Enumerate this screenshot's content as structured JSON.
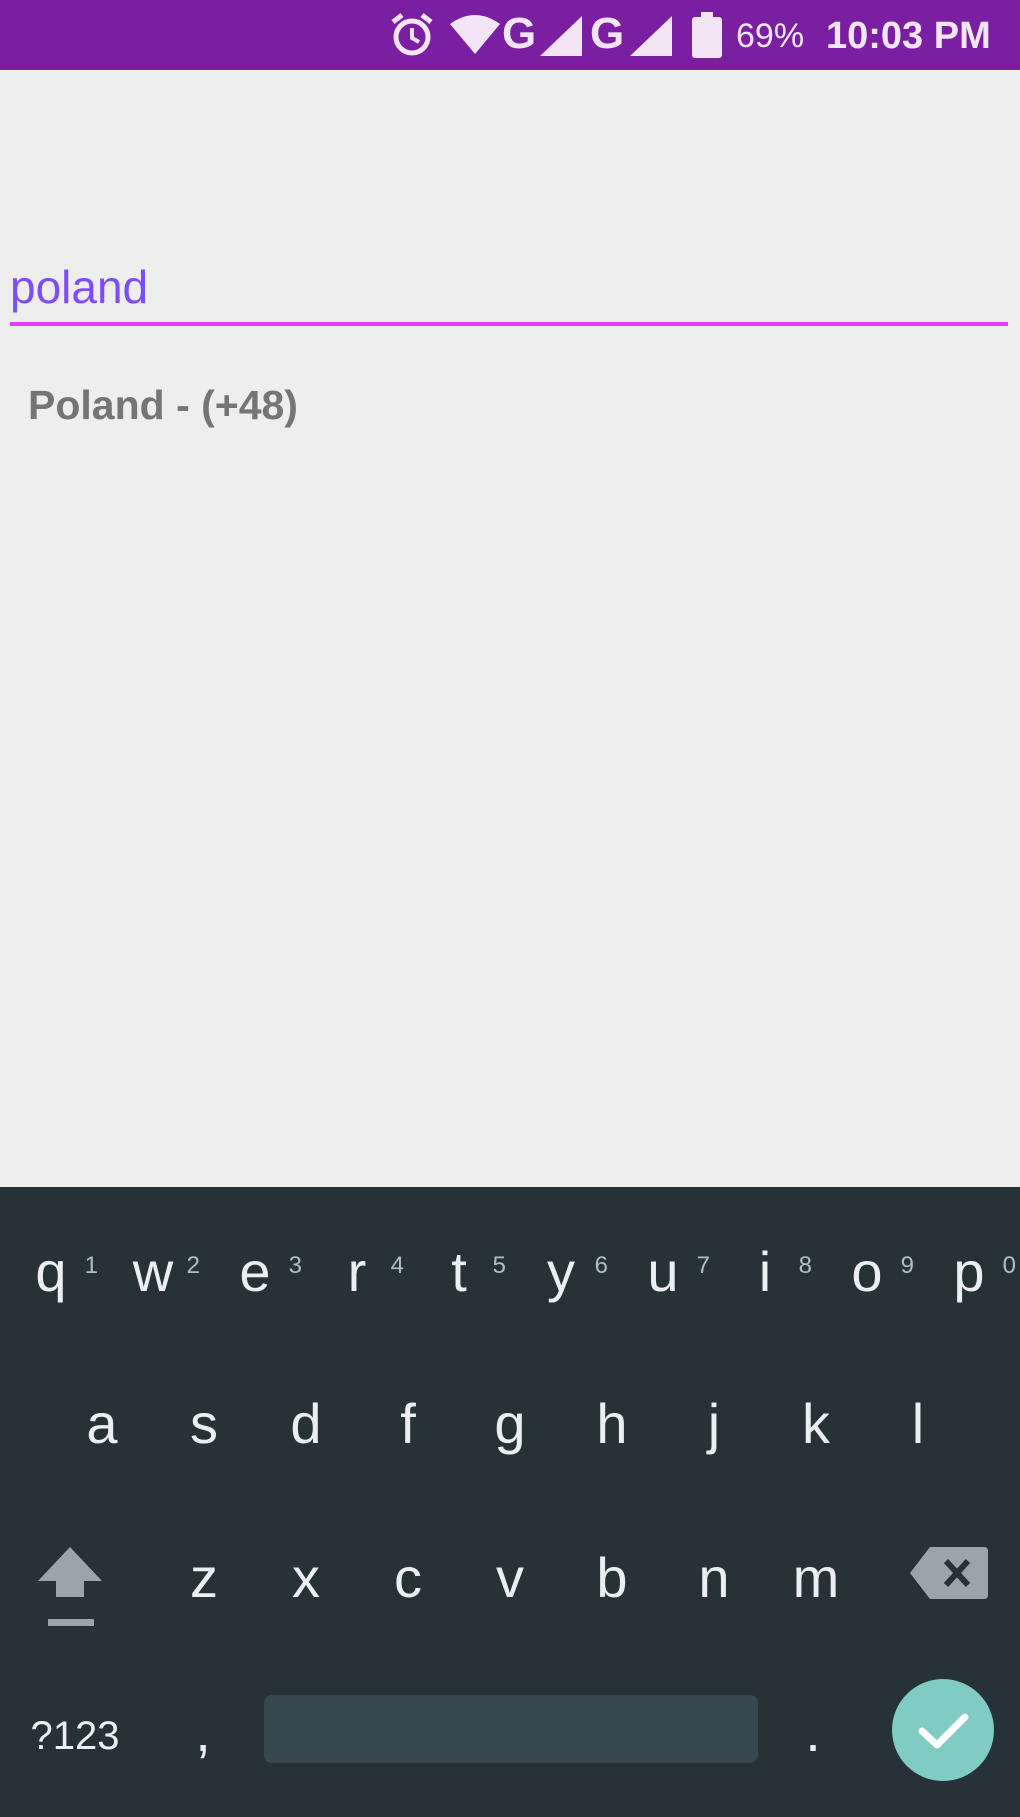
{
  "status_bar": {
    "network_g1": "G",
    "network_g2": "G",
    "battery": "69%",
    "time": "10:03 PM",
    "icons": [
      "alarm-icon",
      "wifi-icon",
      "signal-icon",
      "signal-icon",
      "battery-icon"
    ],
    "color": "#7b1fa2"
  },
  "search": {
    "value": "poland",
    "accent": "#e040fb",
    "text_color": "#7c4dff"
  },
  "results": [
    {
      "label": "Poland - (+48)"
    }
  ],
  "keyboard": {
    "row1": [
      {
        "key": "q",
        "hint": "1"
      },
      {
        "key": "w",
        "hint": "2"
      },
      {
        "key": "e",
        "hint": "3"
      },
      {
        "key": "r",
        "hint": "4"
      },
      {
        "key": "t",
        "hint": "5"
      },
      {
        "key": "y",
        "hint": "6"
      },
      {
        "key": "u",
        "hint": "7"
      },
      {
        "key": "i",
        "hint": "8"
      },
      {
        "key": "o",
        "hint": "9"
      },
      {
        "key": "p",
        "hint": "0"
      }
    ],
    "row2": [
      "a",
      "s",
      "d",
      "f",
      "g",
      "h",
      "j",
      "k",
      "l"
    ],
    "row3": [
      "z",
      "x",
      "c",
      "v",
      "b",
      "n",
      "m"
    ],
    "symbols": "?123",
    "comma": ",",
    "period": ".",
    "background": "#263238",
    "done_color": "#80cbc4"
  }
}
